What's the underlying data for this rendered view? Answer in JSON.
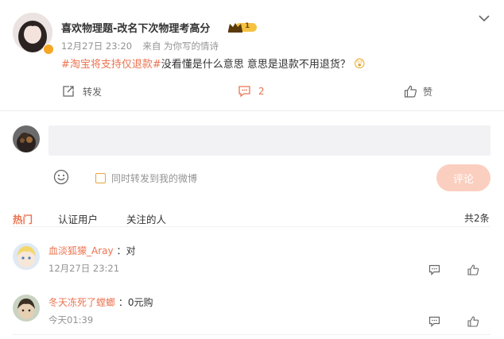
{
  "post": {
    "author": "喜欢物理题-改名下次物理考高分",
    "level_badge": "1",
    "time": "12月27日 23:20",
    "source": "来自 为你写的情诗",
    "hashtag": "#淘宝将支持仅退款#",
    "text": "没看懂是什么意思 意思是退款不用退货？",
    "emoji": "😲",
    "repost_label": "转发",
    "comment_count": "2",
    "like_label": "赞"
  },
  "composer": {
    "placeholder": "",
    "also_repost_label": "同时转发到我的微博",
    "submit_label": "评论"
  },
  "comments_tabs": {
    "tabs": [
      "热门",
      "认证用户",
      "关注的人"
    ],
    "total": "共2条"
  },
  "comments": [
    {
      "user": "血淡狐獴_Aray",
      "text": "：对",
      "time": "12月27日 23:21"
    },
    {
      "user": "冬天冻死了螳螂",
      "text": "：0元购",
      "time": "今天01:39"
    }
  ],
  "colors": {
    "accent": "#eb7350",
    "badge": "#f5c242",
    "submit_bg": "#fbcfbf"
  }
}
